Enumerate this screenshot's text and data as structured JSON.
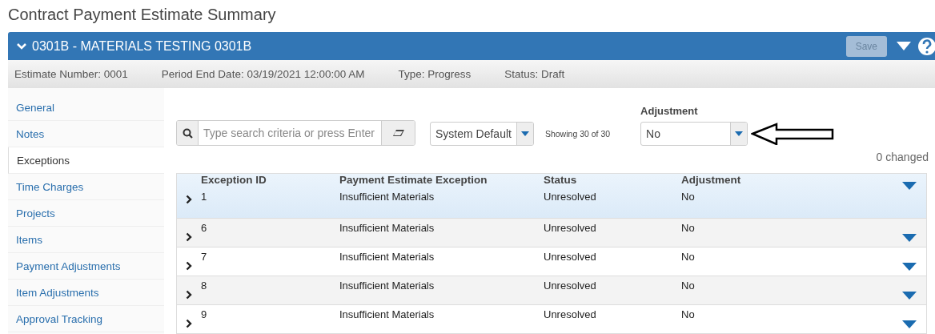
{
  "page_title": "Contract Payment Estimate Summary",
  "header": {
    "title": "0301B - MATERIALS TESTING 0301B",
    "save_button": {
      "label": "Save",
      "disabled": true
    }
  },
  "info_bar": [
    "Estimate Number: 0001",
    "Period End Date: 03/19/2021 12:00:00 AM",
    "Type: Progress",
    "Status: Draft"
  ],
  "sidebar": {
    "items": [
      {
        "label": "General",
        "selected": false
      },
      {
        "label": "Notes",
        "selected": false
      },
      {
        "label": "Exceptions",
        "selected": true
      },
      {
        "label": "Time Charges",
        "selected": false
      },
      {
        "label": "Projects",
        "selected": false
      },
      {
        "label": "Items",
        "selected": false
      },
      {
        "label": "Payment Adjustments",
        "selected": false
      },
      {
        "label": "Item Adjustments",
        "selected": false
      },
      {
        "label": "Approval Tracking",
        "selected": false
      }
    ]
  },
  "toolbar": {
    "search": {
      "placeholder": "Type search criteria or press Enter"
    },
    "view_select": "System Default",
    "count": "Showing 30 of 30",
    "adjustment_filter": {
      "label": "Adjustment",
      "value": "No"
    },
    "changed": "0 changed"
  },
  "table": {
    "columns": [
      "Exception ID",
      "Payment Estimate Exception",
      "Status",
      "Adjustment"
    ],
    "rows": [
      {
        "cells": [
          "1",
          "Insufficient Materials",
          "Unresolved",
          "No"
        ],
        "selected": true
      },
      {
        "cells": [
          "6",
          "Insufficient Materials",
          "Unresolved",
          "No"
        ],
        "selected": false
      },
      {
        "cells": [
          "7",
          "Insufficient Materials",
          "Unresolved",
          "No"
        ],
        "selected": false
      },
      {
        "cells": [
          "8",
          "Insufficient Materials",
          "Unresolved",
          "No"
        ],
        "selected": false
      },
      {
        "cells": [
          "9",
          "Insufficient Materials",
          "Unresolved",
          "No"
        ],
        "selected": false
      }
    ]
  }
}
